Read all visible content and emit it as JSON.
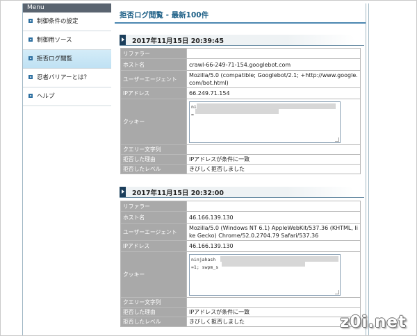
{
  "sidebar": {
    "header": "Menu",
    "items": [
      {
        "label": "制御条件の設定"
      },
      {
        "label": "制御用ソース"
      },
      {
        "label": "拒否ログ閲覧"
      },
      {
        "label": "忍者バリアーとは？"
      },
      {
        "label": "ヘルプ"
      }
    ]
  },
  "page": {
    "title": "拒否ログ閲覧 - 最新100件"
  },
  "fields": {
    "referer": "リファラー",
    "host": "ホスト名",
    "ua": "ユーザーエージェント",
    "ip": "IPアドレス",
    "cookie": "クッキー",
    "query": "クエリー文字列",
    "reason": "拒否した理由",
    "level": "拒否したレベル"
  },
  "entries": [
    {
      "datetime": "2017年11月15日 20:39:45",
      "referer": "",
      "host": "crawl-66-249-71-154.googlebot.com",
      "ua": "Mozilla/5.0 (compatible; Googlebot/2.1; +http://www.google.com/bot.html)",
      "ip": "66.249.71.154",
      "cookie_line1": "ni",
      "cookie_line2": "=",
      "query": "",
      "reason": "IPアドレスが条件に一致",
      "level": "きびしく拒否しました"
    },
    {
      "datetime": "2017年11月15日 20:32:00",
      "referer": "",
      "host": "46.166.139.130",
      "ua": "Mozilla/5.0 (Windows NT 6.1) AppleWebKit/537.36 (KHTML, like Gecko) Chrome/52.0.2704.79 Safari/537.36",
      "ip": "46.166.139.130",
      "cookie_line1": "ninjahash",
      "cookie_line2": "=1; swpm_s",
      "query": "",
      "reason": "IPアドレスが条件に一致",
      "level": "きびしく拒否しました"
    }
  ],
  "watermark": "z0i.net"
}
